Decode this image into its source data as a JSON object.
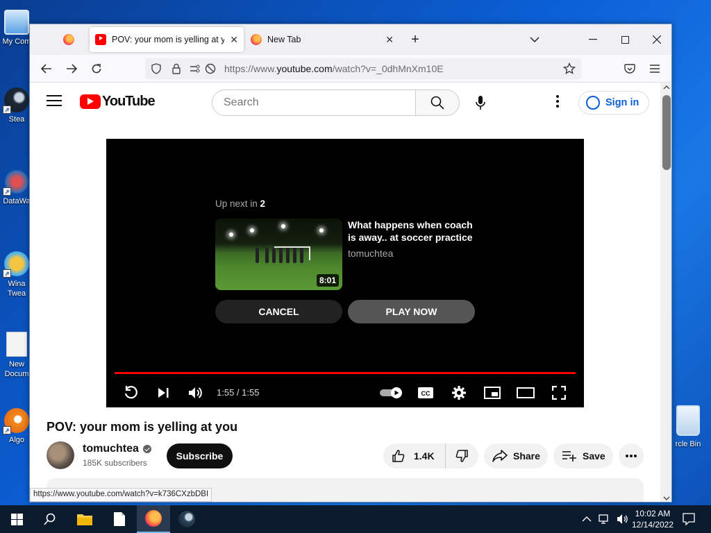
{
  "desktop": {
    "icons": [
      {
        "label": "My Com",
        "icon": "computer-icon"
      },
      {
        "label": "Stea",
        "icon": "steam-icon"
      },
      {
        "label": "DataWa",
        "icon": "datawarrior-icon"
      },
      {
        "label": "Wina Twea",
        "icon": "winaero-icon"
      },
      {
        "label": "New Docum",
        "icon": "document-icon"
      },
      {
        "label": "Algo",
        "icon": "algodoo-icon"
      }
    ],
    "recycle_bin": {
      "label": "rcle Bin",
      "icon": "recycle-bin-icon"
    }
  },
  "browser": {
    "tabs": [
      {
        "title": "",
        "icon": "firefox-icon"
      },
      {
        "title": "POV: your mom is yelling at you",
        "icon": "youtube-icon",
        "active": true
      },
      {
        "title": "New Tab",
        "icon": "firefox-icon"
      }
    ],
    "new_tab": "+",
    "list_tabs": "⌄",
    "window_controls": {
      "minimize": "—",
      "maximize": "☐",
      "close": "✕"
    },
    "url": {
      "prefix": "https://www.",
      "host": "youtube.com",
      "path": "/watch?v=_0dhMnXm10E"
    },
    "status_url": "https://www.youtube.com/watch?v=k736CXzbDBI"
  },
  "youtube": {
    "logo_text": "YouTube",
    "search_placeholder": "Search",
    "sign_in": "Sign in",
    "player": {
      "up_next_label": "Up next in ",
      "up_next_seconds": "2",
      "next_title": "What happens when coach is away.. at soccer practice",
      "next_channel": "tomuchtea",
      "next_duration": "8:01",
      "cancel": "CANCEL",
      "play_now": "PLAY NOW",
      "time": "1:55 / 1:55",
      "progress": 1.0,
      "cc_label": "CC"
    },
    "video": {
      "title": "POV: your mom is yelling at you",
      "channel": "tomuchtea",
      "subscribers": "185K subscribers",
      "subscribe": "Subscribe",
      "likes": "1.4K",
      "share": "Share",
      "save": "Save"
    }
  },
  "taskbar": {
    "clock_time": "10:02 AM",
    "clock_date": "12/14/2022",
    "apps": [
      "start-icon",
      "search-icon",
      "file-explorer-icon",
      "notepad-icon",
      "firefox-icon",
      "steam-icon"
    ]
  },
  "colors": {
    "youtube_red": "#ff0000",
    "link_blue": "#065fd4",
    "desktop_blue": "#0b5fd6"
  }
}
